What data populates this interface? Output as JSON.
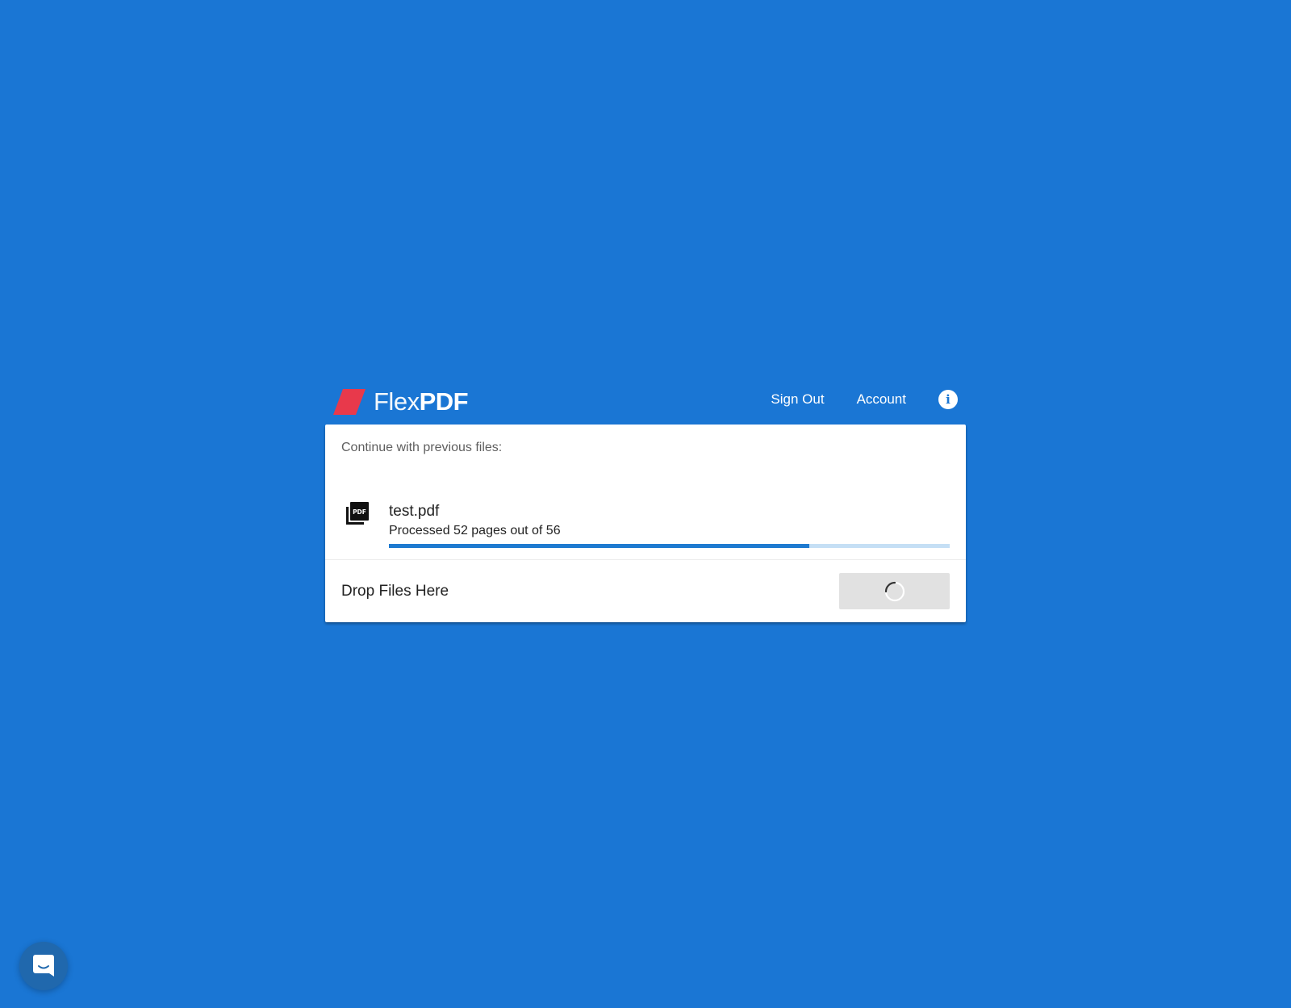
{
  "brand": {
    "name_light": "Flex",
    "name_bold": "PDF",
    "logo_icon": "red-parallelogram-logo",
    "logo_color": "#e8394b"
  },
  "nav": {
    "sign_out": "Sign Out",
    "account": "Account",
    "info_icon": "info-icon",
    "info_glyph": "i"
  },
  "card": {
    "heading": "Continue with previous files:",
    "files": [
      {
        "name": "test.pdf",
        "status": "Processed 52 pages out of 56",
        "pages_processed": 52,
        "pages_total": 56,
        "progress_fraction": 0.75,
        "icon": "pdf-file-icon"
      }
    ],
    "drop_label": "Drop Files Here",
    "upload_button_state": "loading",
    "upload_button_icon": "spinner-icon"
  },
  "chat": {
    "icon": "chat-bubble-icon"
  },
  "colors": {
    "background": "#1a76d4",
    "card": "#ffffff",
    "progress_fill": "#1e7ad0",
    "progress_track": "#c5dff5",
    "button_busy": "#e1e1e1"
  }
}
